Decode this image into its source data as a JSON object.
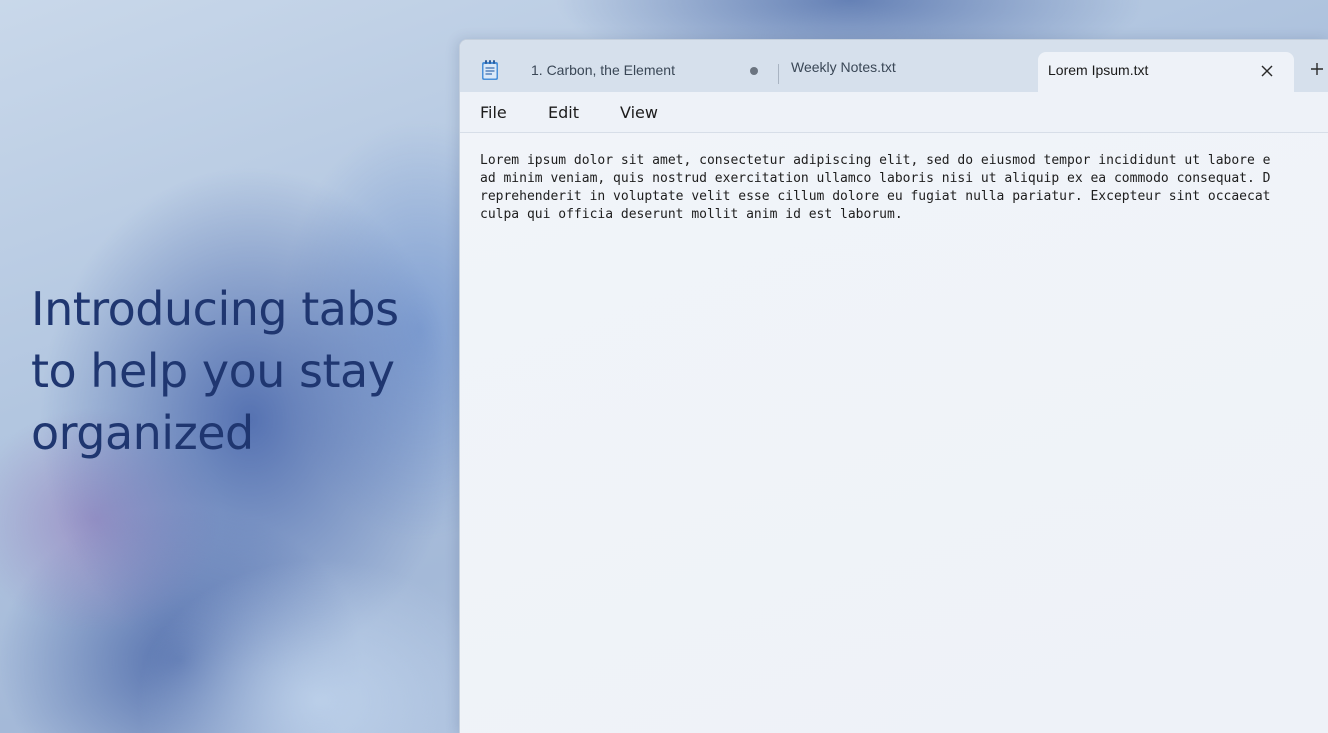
{
  "headline": {
    "line1": "Introducing tabs",
    "line2": "to help you stay",
    "line3": "organized"
  },
  "app": {
    "icon": "notepad-icon"
  },
  "tabs": [
    {
      "label": "1. Carbon, the Element",
      "unsaved": true
    },
    {
      "label": "Weekly Notes.txt"
    },
    {
      "label": "Lorem Ipsum.txt",
      "active": true
    }
  ],
  "menu": {
    "file": "File",
    "edit": "Edit",
    "view": "View"
  },
  "editor": {
    "lines": [
      "Lorem ipsum dolor sit amet, consectetur adipiscing elit, sed do eiusmod tempor incididunt ut labore e",
      "ad minim veniam, quis nostrud exercitation ullamco laboris nisi ut aliquip ex ea commodo consequat. D",
      "reprehenderit in voluptate velit esse cillum dolore eu fugiat nulla pariatur. Excepteur sint occaecat",
      "culpa qui officia deserunt mollit anim id est laborum."
    ]
  },
  "colors": {
    "headline": "#1f3670",
    "tabbar": "#d6e0ec",
    "editor_bg": "#eef2f8"
  }
}
